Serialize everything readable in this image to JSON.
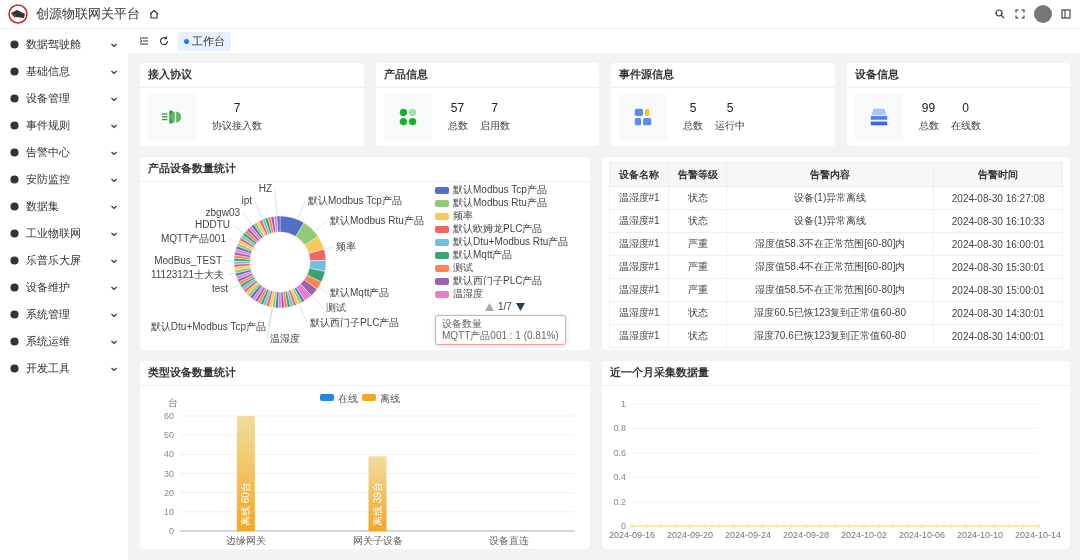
{
  "header": {
    "title": "创源物联网关平台"
  },
  "sidebar": {
    "items": [
      {
        "label": "数据驾驶舱",
        "expanded": false
      },
      {
        "label": "基础信息",
        "expanded": false
      },
      {
        "label": "设备管理",
        "expanded": false
      },
      {
        "label": "事件规则",
        "expanded": false
      },
      {
        "label": "告警中心",
        "expanded": false
      },
      {
        "label": "安防监控",
        "expanded": false
      },
      {
        "label": "数据集",
        "expanded": false
      },
      {
        "label": "工业物联网",
        "expanded": false
      },
      {
        "label": "乐普乐大屏",
        "expanded": false
      },
      {
        "label": "设备维护",
        "expanded": false
      },
      {
        "label": "系统管理",
        "expanded": false
      },
      {
        "label": "系统运维",
        "expanded": false
      },
      {
        "label": "开发工具",
        "expanded": false
      }
    ]
  },
  "tabs": [
    {
      "label": "工作台",
      "selected": true
    }
  ],
  "cards": [
    {
      "title": "接入协议",
      "stats": [
        {
          "value": "7",
          "label": "协议接入数"
        }
      ]
    },
    {
      "title": "产品信息",
      "stats": [
        {
          "value": "57",
          "label": "总数"
        },
        {
          "value": "7",
          "label": "启用数"
        }
      ]
    },
    {
      "title": "事件源信息",
      "stats": [
        {
          "value": "5",
          "label": "总数"
        },
        {
          "value": "5",
          "label": "运行中"
        }
      ]
    },
    {
      "title": "设备信息",
      "stats": [
        {
          "value": "99",
          "label": "总数"
        },
        {
          "value": "0",
          "label": "在线数"
        }
      ]
    }
  ],
  "product_stats": {
    "title": "产品设备数量统计",
    "outer_labels": [
      "HZ",
      "ipt",
      "zbgw03",
      "HDDTU",
      "MQTT产品001",
      "ModBus_TEST",
      "11123121士大夫",
      "test",
      "默认Dtu+Modbus Tcp产品",
      "默认Modbus Tcp产品",
      "默认Modbus Rtu产品",
      "频率",
      "默认Mqtt产品",
      "测试",
      "默认西门子PLC产品",
      "温湿度"
    ],
    "legend": [
      {
        "label": "默认Modbus Tcp产品",
        "color": "#5470c6"
      },
      {
        "label": "默认Modbus Rtu产品",
        "color": "#91cc75"
      },
      {
        "label": "频率",
        "color": "#fac858"
      },
      {
        "label": "默认欧姆龙PLC产品",
        "color": "#ee6666"
      },
      {
        "label": "默认Dtu+Modbus Rtu产品",
        "color": "#73c0de"
      },
      {
        "label": "默认Mqtt产品",
        "color": "#3ba272"
      },
      {
        "label": "测试",
        "color": "#fc8452"
      },
      {
        "label": "默认西门子PLC产品",
        "color": "#9a60b4"
      },
      {
        "label": "温湿度",
        "color": "#ea7ccc"
      }
    ],
    "pager": "1/7",
    "tooltip": {
      "title": "设备数量",
      "text": "MQTT产品001 : 1 (0.81%)"
    }
  },
  "alarms": {
    "columns": [
      "设备名称",
      "告警等级",
      "告警内容",
      "告警时间"
    ],
    "rows": [
      [
        "温湿度#1",
        "状态",
        "设备(1)异常离线",
        "2024-08-30 16:27:08"
      ],
      [
        "温湿度#1",
        "状态",
        "设备(1)异常离线",
        "2024-08-30 16:10:33"
      ],
      [
        "温湿度#1",
        "严重",
        "湿度值58.3不在正常范围[60-80]内",
        "2024-08-30 16:00:01"
      ],
      [
        "温湿度#1",
        "严重",
        "湿度值58.4不在正常范围[60-80]内",
        "2024-08-30 15:30:01"
      ],
      [
        "温湿度#1",
        "严重",
        "湿度值58.5不在正常范围[60-80]内",
        "2024-08-30 15:00:01"
      ],
      [
        "温湿度#1",
        "状态",
        "湿度60.5已恢123复到正常值60-80",
        "2024-08-30 14:30:01"
      ],
      [
        "温湿度#1",
        "状态",
        "湿度70.6已恢123复到正常值60-80",
        "2024-08-30 14:00:01"
      ]
    ]
  },
  "type_stats": {
    "title": "类型设备数量统计",
    "chart_data": {
      "type": "bar",
      "ylabel": "台",
      "categories": [
        "边缘网关",
        "网关子设备",
        "设备直连"
      ],
      "series": [
        {
          "name": "在线",
          "color": "#1e88e5",
          "values": [
            0,
            0,
            0
          ]
        },
        {
          "name": "离线",
          "color": "#f5a623",
          "values": [
            60,
            39,
            0
          ]
        }
      ],
      "ylim": [
        0,
        60
      ],
      "yticks": [
        0,
        10,
        20,
        30,
        40,
        50,
        60
      ],
      "stacked": true,
      "grid": true,
      "value_labels": [
        null,
        [
          "离线 60台",
          "离线 39台",
          null
        ]
      ]
    }
  },
  "monthly": {
    "title": "近一个月采集数据量",
    "chart_data": {
      "type": "line",
      "x": [
        "2024-09-16",
        "2024-09-17",
        "2024-09-18",
        "2024-09-19",
        "2024-09-20",
        "2024-09-21",
        "2024-09-22",
        "2024-09-23",
        "2024-09-24",
        "2024-09-25",
        "2024-09-26",
        "2024-09-27",
        "2024-09-28",
        "2024-09-29",
        "2024-09-30",
        "2024-10-01",
        "2024-10-02",
        "2024-10-03",
        "2024-10-04",
        "2024-10-05",
        "2024-10-06",
        "2024-10-07",
        "2024-10-08",
        "2024-10-09",
        "2024-10-10",
        "2024-10-11",
        "2024-10-12",
        "2024-10-13",
        "2024-10-14"
      ],
      "series": [
        {
          "color": "#f7eba8",
          "values": [
            0,
            0,
            0,
            0,
            0,
            0,
            0,
            0,
            0,
            0,
            0,
            0,
            0,
            0,
            0,
            0,
            0,
            0,
            0,
            0,
            0,
            0,
            0,
            0,
            0,
            0,
            0,
            0,
            0
          ]
        }
      ],
      "xlim": [
        "2024-09-16",
        "2024-10-14"
      ],
      "ylim": [
        0,
        1
      ],
      "grid": true,
      "yticks": [
        0,
        {
          "value": 0.2,
          "label": "0.2"
        },
        {
          "value": 0.4,
          "label": "0.4"
        },
        {
          "value": 0.6,
          "label": "0.6"
        },
        {
          "value": 0.8,
          "label": "0.8"
        },
        1
      ],
      "xticks": [
        "2024-09-16",
        "2024-09-20",
        "2024-09-24",
        "2024-09-28",
        "2024-10-02",
        "2024-10-06",
        "2024-10-10",
        "2024-10-14"
      ]
    }
  }
}
